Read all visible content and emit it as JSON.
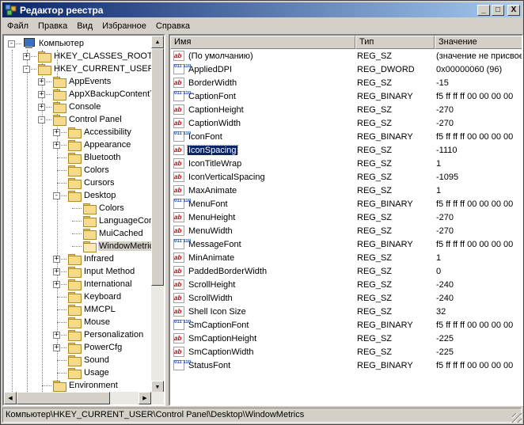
{
  "window": {
    "title": "Редактор реестра",
    "controls": {
      "minimize": "_",
      "maximize": "□",
      "close": "X"
    }
  },
  "menu": [
    "Файл",
    "Правка",
    "Вид",
    "Избранное",
    "Справка"
  ],
  "tree": [
    {
      "label": "Компьютер",
      "level": 0,
      "expander": "-",
      "icon": "computer-icon"
    },
    {
      "label": "HKEY_CLASSES_ROOT",
      "level": 1,
      "expander": "+",
      "icon": "folder-icon"
    },
    {
      "label": "HKEY_CURRENT_USER",
      "level": 1,
      "expander": "-",
      "icon": "folder-icon"
    },
    {
      "label": "AppEvents",
      "level": 2,
      "expander": "+",
      "icon": "folder-icon"
    },
    {
      "label": "AppXBackupContentT",
      "level": 2,
      "expander": "+",
      "icon": "folder-icon"
    },
    {
      "label": "Console",
      "level": 2,
      "expander": "+",
      "icon": "folder-icon"
    },
    {
      "label": "Control Panel",
      "level": 2,
      "expander": "-",
      "icon": "folder-icon"
    },
    {
      "label": "Accessibility",
      "level": 3,
      "expander": "+",
      "icon": "folder-icon"
    },
    {
      "label": "Appearance",
      "level": 3,
      "expander": "+",
      "icon": "folder-icon"
    },
    {
      "label": "Bluetooth",
      "level": 3,
      "expander": "",
      "icon": "folder-icon"
    },
    {
      "label": "Colors",
      "level": 3,
      "expander": "",
      "icon": "folder-icon"
    },
    {
      "label": "Cursors",
      "level": 3,
      "expander": "",
      "icon": "folder-icon"
    },
    {
      "label": "Desktop",
      "level": 3,
      "expander": "-",
      "icon": "folder-icon"
    },
    {
      "label": "Colors",
      "level": 4,
      "expander": "",
      "icon": "folder-icon"
    },
    {
      "label": "LanguageCon",
      "level": 4,
      "expander": "",
      "icon": "folder-icon"
    },
    {
      "label": "MuiCached",
      "level": 4,
      "expander": "",
      "icon": "folder-icon"
    },
    {
      "label": "WindowMetric",
      "level": 4,
      "expander": "",
      "icon": "folder-icon-open",
      "selected": true
    },
    {
      "label": "Infrared",
      "level": 3,
      "expander": "+",
      "icon": "folder-icon"
    },
    {
      "label": "Input Method",
      "level": 3,
      "expander": "+",
      "icon": "folder-icon"
    },
    {
      "label": "International",
      "level": 3,
      "expander": "+",
      "icon": "folder-icon"
    },
    {
      "label": "Keyboard",
      "level": 3,
      "expander": "",
      "icon": "folder-icon"
    },
    {
      "label": "MMCPL",
      "level": 3,
      "expander": "",
      "icon": "folder-icon"
    },
    {
      "label": "Mouse",
      "level": 3,
      "expander": "",
      "icon": "folder-icon"
    },
    {
      "label": "Personalization",
      "level": 3,
      "expander": "+",
      "icon": "folder-icon"
    },
    {
      "label": "PowerCfg",
      "level": 3,
      "expander": "+",
      "icon": "folder-icon"
    },
    {
      "label": "Sound",
      "level": 3,
      "expander": "",
      "icon": "folder-icon"
    },
    {
      "label": "Usage",
      "level": 3,
      "expander": "",
      "icon": "folder-icon"
    },
    {
      "label": "Environment",
      "level": 2,
      "expander": "",
      "icon": "folder-icon"
    }
  ],
  "list": {
    "columns": [
      "Имя",
      "Тип",
      "Значение"
    ],
    "rows": [
      {
        "name": "(По умолчанию)",
        "type": "REG_SZ",
        "data": "(значение не присвоено)",
        "icon": "string-value-icon"
      },
      {
        "name": "AppliedDPI",
        "type": "REG_DWORD",
        "data": "0x00000060 (96)",
        "icon": "binary-value-icon"
      },
      {
        "name": "BorderWidth",
        "type": "REG_SZ",
        "data": "-15",
        "icon": "string-value-icon"
      },
      {
        "name": "CaptionFont",
        "type": "REG_BINARY",
        "data": "f5 ff ff ff 00 00 00 00",
        "icon": "binary-value-icon"
      },
      {
        "name": "CaptionHeight",
        "type": "REG_SZ",
        "data": "-270",
        "icon": "string-value-icon"
      },
      {
        "name": "CaptionWidth",
        "type": "REG_SZ",
        "data": "-270",
        "icon": "string-value-icon"
      },
      {
        "name": "IconFont",
        "type": "REG_BINARY",
        "data": "f5 ff ff ff 00 00 00 00",
        "icon": "binary-value-icon"
      },
      {
        "name": "IconSpacing",
        "type": "REG_SZ",
        "data": "-1110",
        "icon": "string-value-icon",
        "selected": true
      },
      {
        "name": "IconTitleWrap",
        "type": "REG_SZ",
        "data": "1",
        "icon": "string-value-icon"
      },
      {
        "name": "IconVerticalSpacing",
        "type": "REG_SZ",
        "data": "-1095",
        "icon": "string-value-icon"
      },
      {
        "name": "MaxAnimate",
        "type": "REG_SZ",
        "data": "1",
        "icon": "string-value-icon"
      },
      {
        "name": "MenuFont",
        "type": "REG_BINARY",
        "data": "f5 ff ff ff 00 00 00 00",
        "icon": "binary-value-icon"
      },
      {
        "name": "MenuHeight",
        "type": "REG_SZ",
        "data": "-270",
        "icon": "string-value-icon"
      },
      {
        "name": "MenuWidth",
        "type": "REG_SZ",
        "data": "-270",
        "icon": "string-value-icon"
      },
      {
        "name": "MessageFont",
        "type": "REG_BINARY",
        "data": "f5 ff ff ff 00 00 00 00",
        "icon": "binary-value-icon"
      },
      {
        "name": "MinAnimate",
        "type": "REG_SZ",
        "data": "1",
        "icon": "string-value-icon"
      },
      {
        "name": "PaddedBorderWidth",
        "type": "REG_SZ",
        "data": "0",
        "icon": "string-value-icon"
      },
      {
        "name": "ScrollHeight",
        "type": "REG_SZ",
        "data": "-240",
        "icon": "string-value-icon"
      },
      {
        "name": "ScrollWidth",
        "type": "REG_SZ",
        "data": "-240",
        "icon": "string-value-icon"
      },
      {
        "name": "Shell Icon Size",
        "type": "REG_SZ",
        "data": "32",
        "icon": "string-value-icon"
      },
      {
        "name": "SmCaptionFont",
        "type": "REG_BINARY",
        "data": "f5 ff ff ff 00 00 00 00",
        "icon": "binary-value-icon"
      },
      {
        "name": "SmCaptionHeight",
        "type": "REG_SZ",
        "data": "-225",
        "icon": "string-value-icon"
      },
      {
        "name": "SmCaptionWidth",
        "type": "REG_SZ",
        "data": "-225",
        "icon": "string-value-icon"
      },
      {
        "name": "StatusFont",
        "type": "REG_BINARY",
        "data": "f5 ff ff ff 00 00 00 00",
        "icon": "binary-value-icon"
      }
    ]
  },
  "statusbar": {
    "path": "Компьютер\\HKEY_CURRENT_USER\\Control Panel\\Desktop\\WindowMetrics"
  },
  "icons": {
    "string_glyph": "ab",
    "binary_glyph": "011 110"
  }
}
